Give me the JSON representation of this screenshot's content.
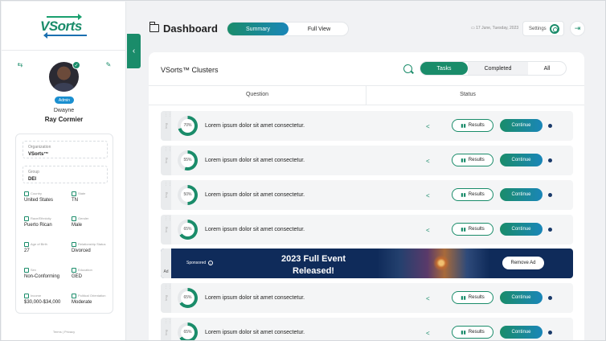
{
  "logo": {
    "text": "VSorts"
  },
  "sidebar": {
    "user": {
      "role": "Admin",
      "first_name": "Dwayne",
      "last_name": "Ray Cormier"
    },
    "organization": {
      "label": "Organization",
      "value": "VSorts™"
    },
    "group": {
      "label": "Group",
      "value": "DEI"
    },
    "fields": [
      {
        "label": "Country",
        "value": "United States"
      },
      {
        "label": "State",
        "value": "TN"
      },
      {
        "label": "Race/Ethnicity",
        "value": "Puerto Rican"
      },
      {
        "label": "Gender",
        "value": "Male"
      },
      {
        "label": "Age of Birth",
        "value": "27"
      },
      {
        "label": "Relationship Status",
        "value": "Divorced"
      },
      {
        "label": "Sex",
        "value": "Non-Conforming"
      },
      {
        "label": "Education",
        "value": "GED"
      },
      {
        "label": "Income",
        "value": "$30,000-$34,000"
      },
      {
        "label": "Political Orientation",
        "value": "Moderate"
      }
    ],
    "footer": "Terms  |  Privacy"
  },
  "header": {
    "title": "Dashboard",
    "view_tabs": [
      "Summary",
      "Full View"
    ],
    "date": "17 June, Tuesday, 2023",
    "settings_label": "Settings"
  },
  "main": {
    "title": "VSorts™ Clusters",
    "filter_tabs": [
      "Tasks",
      "Completed",
      "All"
    ],
    "columns": [
      "Question",
      "Status"
    ],
    "rows": [
      {
        "tag": "Img",
        "percent": "70%",
        "pct_value": 70,
        "question": "Lorem ipsum dolor sit amet consectetur.",
        "results_label": "Results",
        "continue_label": "Continue"
      },
      {
        "tag": "Img",
        "percent": "55%",
        "pct_value": 55,
        "question": "Lorem ipsum dolor sit amet consectetur.",
        "results_label": "Results",
        "continue_label": "Continue"
      },
      {
        "tag": "Img",
        "percent": "50%",
        "pct_value": 50,
        "question": "Lorem ipsum dolor sit amet consectetur.",
        "results_label": "Results",
        "continue_label": "Continue"
      },
      {
        "tag": "Img",
        "percent": "65%",
        "pct_value": 65,
        "question": "Lorem ipsum dolor sit amet consectetur.",
        "results_label": "Results",
        "continue_label": "Continue"
      },
      {
        "tag": "Img",
        "percent": "65%",
        "pct_value": 65,
        "question": "Lorem ipsum dolor sit amet consectetur.",
        "results_label": "Results",
        "continue_label": "Continue"
      },
      {
        "tag": "Img",
        "percent": "65%",
        "pct_value": 65,
        "question": "Lorem ipsum dolor sit amet consectetur.",
        "results_label": "Results",
        "continue_label": "Continue"
      }
    ],
    "ad": {
      "tag": "Ad",
      "sponsored": "Sponsored",
      "headline": "2023 Full Event Released!",
      "remove_label": "Remove Ad"
    }
  },
  "colors": {
    "accent": "#1a8c6a",
    "accent_blue": "#1a86b8",
    "ad_bg": "#0f2b5a"
  }
}
